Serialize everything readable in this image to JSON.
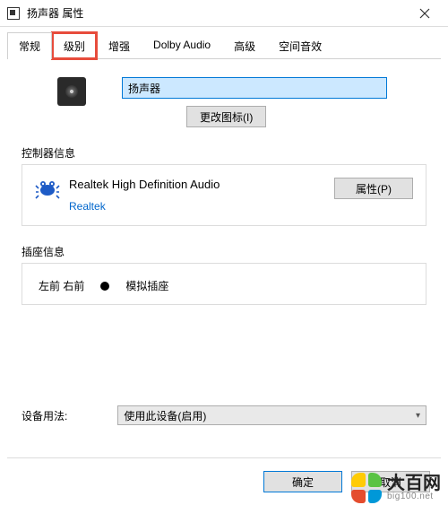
{
  "window": {
    "title": "扬声器 属性"
  },
  "tabs": {
    "items": [
      "常规",
      "级别",
      "增强",
      "Dolby Audio",
      "高级",
      "空间音效"
    ],
    "active_index": 0,
    "highlight_index": 1
  },
  "general": {
    "device_name": "扬声器",
    "change_icon_label": "更改图标(I)"
  },
  "controller": {
    "group_label": "控制器信息",
    "name": "Realtek High Definition Audio",
    "vendor": "Realtek",
    "properties_button": "属性(P)"
  },
  "jack": {
    "group_label": "插座信息",
    "position": "左前  右前",
    "type": "模拟插座"
  },
  "usage": {
    "label": "设备用法:",
    "selected": "使用此设备(启用)"
  },
  "buttons": {
    "ok": "确定",
    "cancel": "取消"
  },
  "watermark": {
    "brand": "大百网",
    "url": "big100.net"
  }
}
